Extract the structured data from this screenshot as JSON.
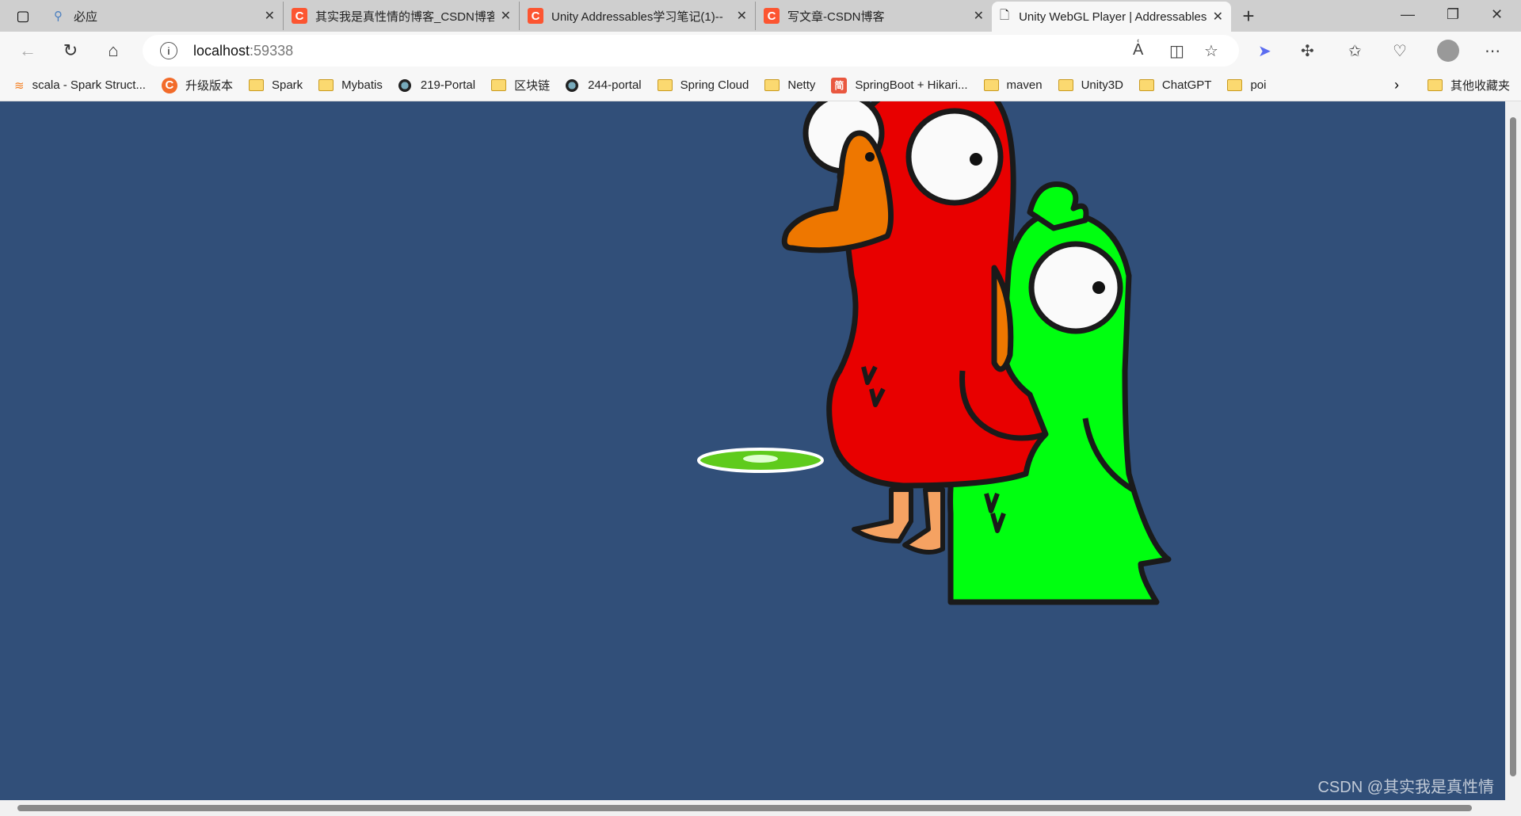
{
  "browser": {
    "tabs": [
      {
        "title": "必应",
        "icon": "search-icon"
      },
      {
        "title": "其实我是真性情的博客_CSDN博客",
        "icon": "csdn-icon"
      },
      {
        "title": "Unity Addressables学习笔记(1)--",
        "icon": "csdn-icon"
      },
      {
        "title": "写文章-CSDN博客",
        "icon": "csdn-icon"
      },
      {
        "title": "Unity WebGL Player | Addressables",
        "icon": "page-icon",
        "active": true
      }
    ],
    "address": {
      "host": "localhost",
      "port": ":59338"
    },
    "bookmarks": [
      {
        "label": "scala - Spark Struct...",
        "icon": "stackoverflow-icon"
      },
      {
        "label": "升级版本",
        "icon": "csdn-icon"
      },
      {
        "label": "Spark",
        "icon": "folder-icon"
      },
      {
        "label": "Mybatis",
        "icon": "folder-icon"
      },
      {
        "label": "219-Portal",
        "icon": "bmw-icon"
      },
      {
        "label": "区块链",
        "icon": "folder-icon"
      },
      {
        "label": "244-portal",
        "icon": "bmw-icon"
      },
      {
        "label": "Spring Cloud",
        "icon": "folder-icon"
      },
      {
        "label": "Netty",
        "icon": "folder-icon"
      },
      {
        "label": "SpringBoot + Hikari...",
        "icon": "jianshu-icon"
      },
      {
        "label": "maven",
        "icon": "folder-icon"
      },
      {
        "label": "Unity3D",
        "icon": "folder-icon"
      },
      {
        "label": "ChatGPT",
        "icon": "folder-icon"
      },
      {
        "label": "poi",
        "icon": "folder-icon"
      }
    ],
    "other_bookmarks": "其他收藏夹"
  },
  "content": {
    "background": "#314f79",
    "watermark": "CSDN @其实我是真性情"
  },
  "colors": {
    "red_duck": "#e80000",
    "green_duck": "#00ff10",
    "beak": "#ee7700",
    "disc": "#5fcb1c"
  }
}
